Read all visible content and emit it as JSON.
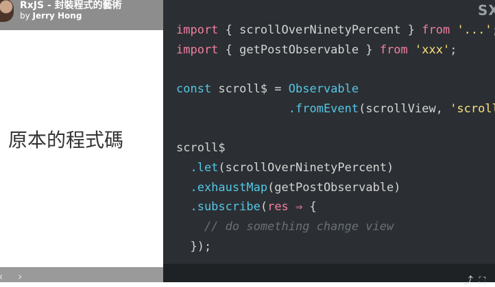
{
  "header": {
    "title": "RxJS - 封裝程式的藝術",
    "by_prefix": "by ",
    "author": "Jerry Hong"
  },
  "slide": {
    "heading": "原本的程式碼"
  },
  "watermark": "SX",
  "code": {
    "l1": {
      "kw1": "import",
      "p1": " { scrollOverNinetyPercent } ",
      "kw2": "from",
      "p2": " ",
      "str": "'...'",
      "p3": ";"
    },
    "l2": {
      "kw1": "import",
      "p1": " { getPostObservable } ",
      "kw2": "from",
      "p2": " ",
      "str": "'xxx'",
      "p3": ";"
    },
    "l4": {
      "kw": "const",
      "p1": " scroll$ = ",
      "fn": "Observable"
    },
    "l5": {
      "indent": "                ",
      "fn": ".fromEvent",
      "p1": "(scrollView, ",
      "str": "'scroll'",
      "p2": ")"
    },
    "l7": {
      "text": "scroll$"
    },
    "l8": {
      "fn": "  .let",
      "p1": "(scrollOverNinetyPercent)"
    },
    "l9": {
      "fn": "  .exhaustMap",
      "p1": "(getPostObservable)"
    },
    "l10": {
      "fn": "  .subscribe",
      "p1": "(",
      "kw": "res",
      "arrow": " ⇒ ",
      "p2": "{"
    },
    "l11": {
      "comment": "    // do something change view"
    },
    "l12": {
      "text": "  });"
    }
  },
  "nav": {
    "prev": "‹",
    "next": "›"
  },
  "controls": {
    "share": "⤴",
    "fullscreen": "⛶"
  },
  "colors": {
    "keyword": "#f47fa0",
    "string": "#fbe17e",
    "function": "#55c7e6",
    "comment": "#6a7077",
    "code_bg": "#2b2f33"
  }
}
